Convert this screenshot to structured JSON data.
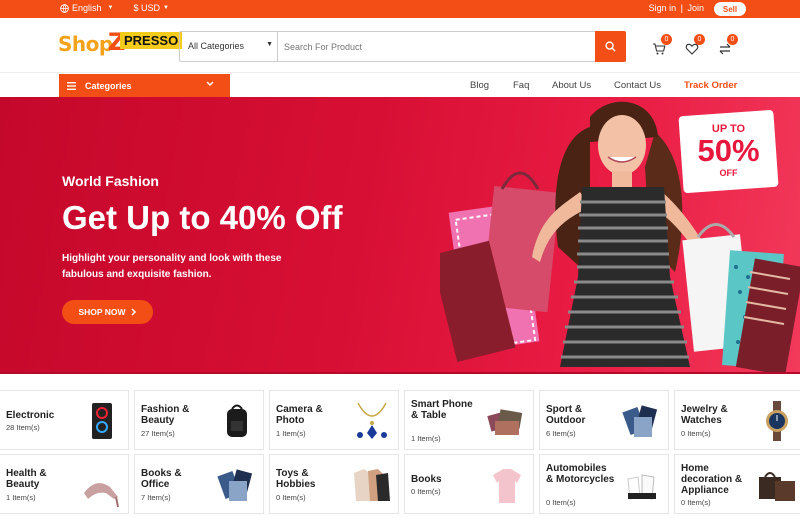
{
  "topbar": {
    "language": "English",
    "currency": "$ USD",
    "sign_in": "Sign in",
    "separator": "|",
    "join": "Join",
    "sell": "Sell"
  },
  "header": {
    "logo": {
      "part1": "Shop",
      "part2": "Z",
      "part3": "PRESSO"
    },
    "search": {
      "category": "All Categories",
      "placeholder": "Search For Product"
    },
    "icons": [
      {
        "name": "cart-icon",
        "badge": "0"
      },
      {
        "name": "heart-icon",
        "badge": "0"
      },
      {
        "name": "compare-icon",
        "badge": "0"
      }
    ]
  },
  "nav": {
    "categories_label": "Categories",
    "links": [
      "Blog",
      "Faq",
      "About Us",
      "Contact Us",
      "Track Order"
    ]
  },
  "hero": {
    "subtitle": "World Fashion",
    "title": "Get Up to 40% Off",
    "description": "Highlight your personality and look with these fabulous and exquisite fashion.",
    "button": "SHOP NOW",
    "promo": {
      "line1": "UP TO",
      "line2": "50%",
      "line3": "OFF"
    }
  },
  "categories": [
    {
      "name": "Electronic",
      "count": "28 Item(s)",
      "icon": "pc-case"
    },
    {
      "name": "Fashion & Beauty",
      "count": "27 Item(s)",
      "icon": "backpack"
    },
    {
      "name": "Camera & Photo",
      "count": "1 Item(s)",
      "icon": "necklace"
    },
    {
      "name": "Smart Phone & Table",
      "count": "1 Item(s)",
      "icon": "wallets"
    },
    {
      "name": "Sport & Outdoor",
      "count": "6 Item(s)",
      "icon": "clothes"
    },
    {
      "name": "Jewelry & Watches",
      "count": "0 Item(s)",
      "icon": "watch"
    },
    {
      "name": "Health & Beauty",
      "count": "1 Item(s)",
      "icon": "heels"
    },
    {
      "name": "Books & Office",
      "count": "7 Item(s)",
      "icon": "clothes"
    },
    {
      "name": "Toys & Hobbies",
      "count": "0 Item(s)",
      "icon": "shirts"
    },
    {
      "name": "Books",
      "count": "0 Item(s)",
      "icon": "shirt"
    },
    {
      "name": "Automobiles & Motorcycles",
      "count": "0 Item(s)",
      "icon": "gloves"
    },
    {
      "name": "Home decoration & Appliance",
      "count": "0 Item(s)",
      "icon": "bags"
    }
  ],
  "colors": {
    "accent": "#f24e16",
    "hero": "#d80f34",
    "brand_yellow": "#f5cb1b"
  }
}
